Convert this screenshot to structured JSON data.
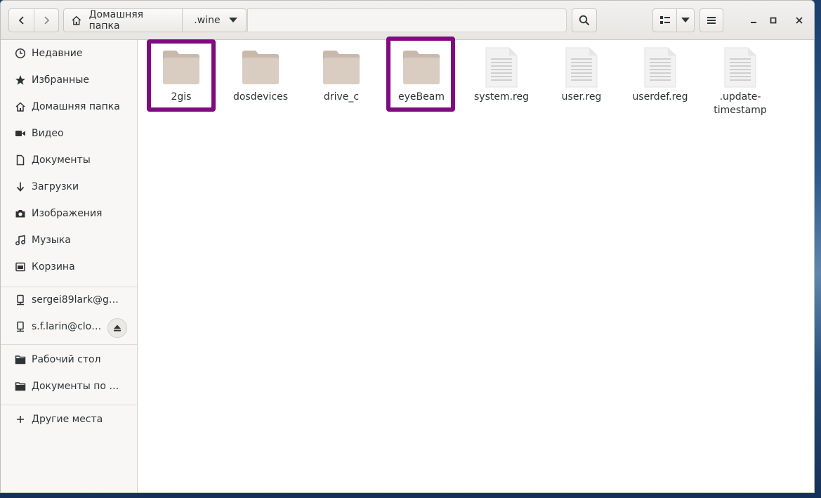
{
  "toolbar": {
    "back_icon": "chevron-left-icon",
    "forward_icon": "chevron-right-icon",
    "search_icon": "search-icon",
    "view_icon": "list-view-icon",
    "menu_icon": "hamburger-menu-icon"
  },
  "pathbar": {
    "home_label": "Домашняя папка",
    "current_label": ".wine"
  },
  "sidebar": {
    "places": [
      {
        "label": "Недавние",
        "icon": "clock-icon"
      },
      {
        "label": "Избранные",
        "icon": "star-icon"
      },
      {
        "label": "Домашняя папка",
        "icon": "home-icon"
      },
      {
        "label": "Видео",
        "icon": "video-icon"
      },
      {
        "label": "Документы",
        "icon": "document-icon"
      },
      {
        "label": "Загрузки",
        "icon": "download-icon"
      },
      {
        "label": "Изображения",
        "icon": "camera-icon"
      },
      {
        "label": "Музыка",
        "icon": "music-icon"
      },
      {
        "label": "Корзина",
        "icon": "trash-icon"
      }
    ],
    "network": [
      {
        "label": "sergei89lark@g…",
        "icon": "network-drive-icon"
      },
      {
        "label": "s.f.larin@clo…",
        "icon": "network-drive-icon"
      }
    ],
    "bookmarks": [
      {
        "label": "Рабочий стол",
        "icon": "folder-icon"
      },
      {
        "label": "Документы по ра…",
        "icon": "folder-icon"
      }
    ],
    "other": {
      "label": "Другие места",
      "icon": "plus-icon"
    }
  },
  "files": [
    {
      "name": "2gis",
      "type": "folder"
    },
    {
      "name": "dosdevices",
      "type": "folder"
    },
    {
      "name": "drive_c",
      "type": "folder"
    },
    {
      "name": "eyeBeam",
      "type": "folder"
    },
    {
      "name": "system.reg",
      "type": "text-file"
    },
    {
      "name": "user.reg",
      "type": "text-file"
    },
    {
      "name": "userdef.reg",
      "type": "text-file"
    },
    {
      "name_line1": ".update-",
      "name_line2": "timestamp",
      "type": "text-file"
    }
  ],
  "colors": {
    "highlight": "#800a80",
    "folder": "#d9ccc1",
    "folder_tab": "#c8b9ab"
  }
}
